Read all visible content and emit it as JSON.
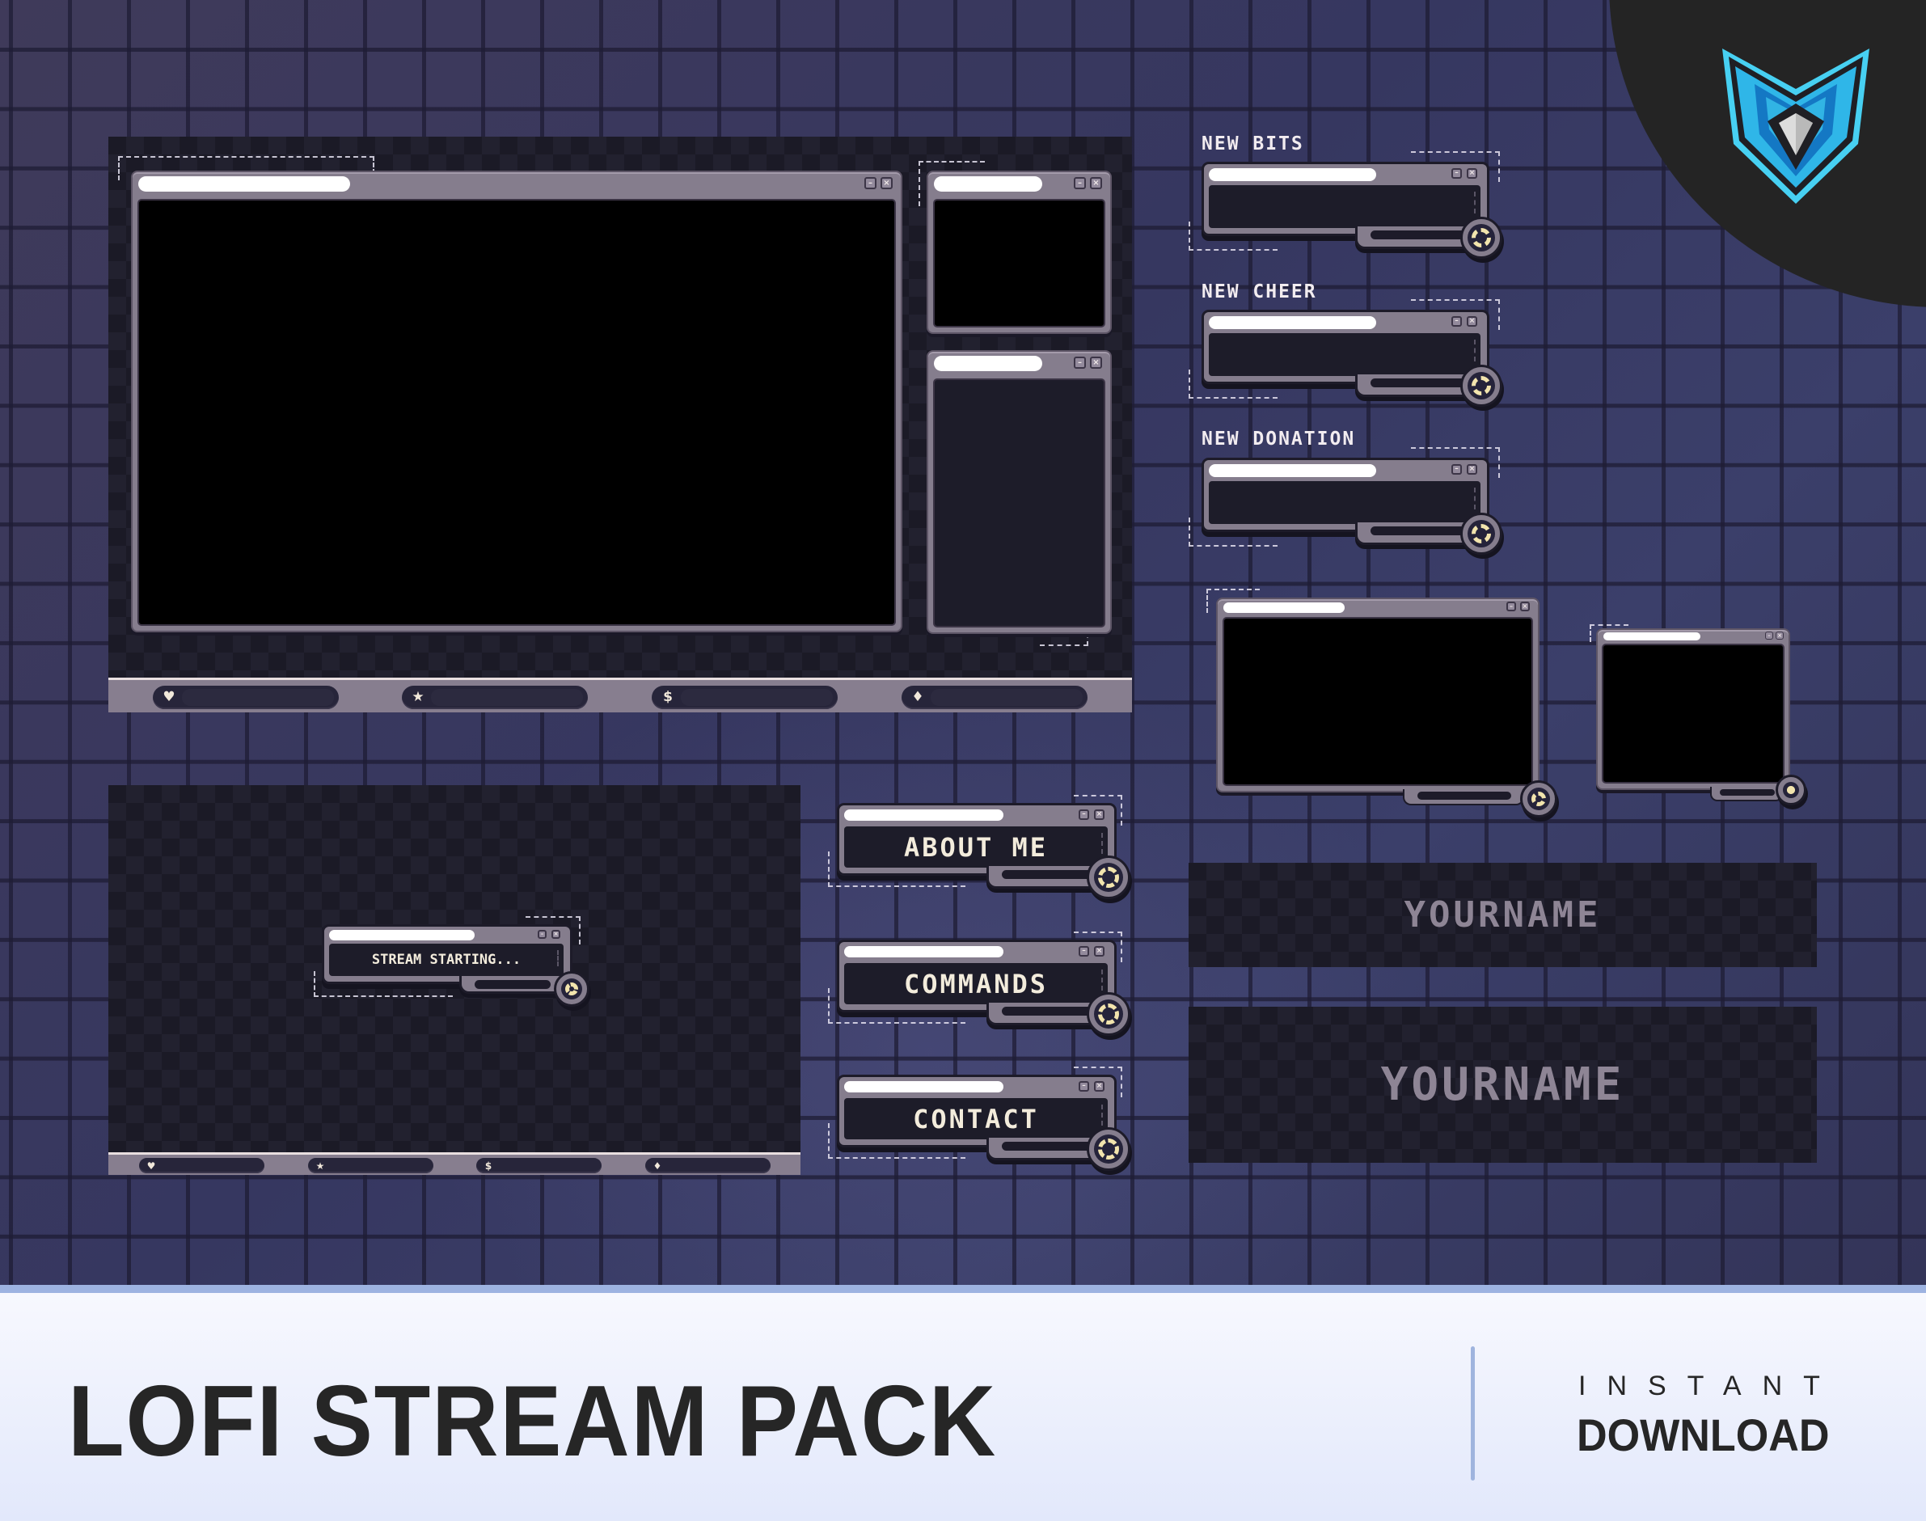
{
  "branding": {
    "logo_icon": "shield-v-diamond-logo",
    "colors": {
      "accent_blue": "#3fc3ee",
      "panel_gray": "#857d8d",
      "dark": "#1d1c29",
      "cream": "#f1e8da"
    }
  },
  "main_overlay": {
    "window_controls": [
      "minimize",
      "close"
    ],
    "stat_bar": [
      {
        "icon": "heart-icon",
        "glyph": "♥"
      },
      {
        "icon": "star-icon",
        "glyph": "★"
      },
      {
        "icon": "dollar-icon",
        "glyph": "$"
      },
      {
        "icon": "diamond-icon",
        "glyph": "♦"
      }
    ]
  },
  "alerts": [
    {
      "label": "NEW BITS"
    },
    {
      "label": "NEW CHEER"
    },
    {
      "label": "NEW DONATION"
    }
  ],
  "starting_screen": {
    "message": "STREAM STARTING...",
    "stat_bar": [
      {
        "icon": "heart-icon",
        "glyph": "♥"
      },
      {
        "icon": "star-icon",
        "glyph": "★"
      },
      {
        "icon": "dollar-icon",
        "glyph": "$"
      },
      {
        "icon": "diamond-icon",
        "glyph": "♦"
      }
    ]
  },
  "panels": [
    {
      "label": "ABOUT ME"
    },
    {
      "label": "COMMANDS"
    },
    {
      "label": "CONTACT"
    }
  ],
  "banners": [
    {
      "text": "YOURNAME"
    },
    {
      "text": "YOURNAME"
    }
  ],
  "footer": {
    "title": "LOFI STREAM PACK",
    "tag_top": "INSTANT",
    "tag_bottom": "DOWNLOAD"
  }
}
